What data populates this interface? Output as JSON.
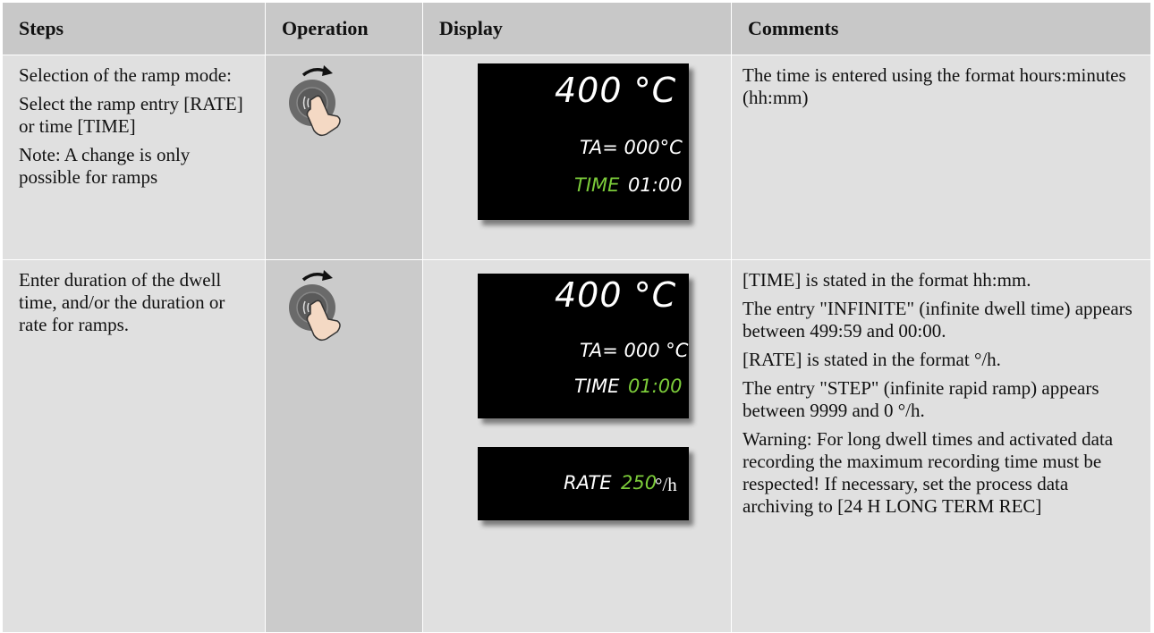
{
  "headers": {
    "steps": "Steps",
    "operation": "Operation",
    "display": "Display",
    "comments": "Comments"
  },
  "rows": [
    {
      "steps": [
        "Selection of the ramp mode:",
        "Select the ramp entry [RATE] or time [TIME]",
        "Note: A change is only possible for ramps"
      ],
      "display": {
        "temp": "400 °C",
        "ta": "TA= 000°C",
        "time_label": "TIME",
        "time_value": "01:00"
      },
      "comments": [
        "The time is entered using the format hours:minutes (hh:mm)"
      ]
    },
    {
      "steps": [
        "Enter duration of the dwell time, and/or the duration or rate for ramps."
      ],
      "display": {
        "temp": "400 °C",
        "ta": "TA= 000 °C",
        "time_label": "TIME",
        "time_value": "01:00",
        "rate_label": "RATE",
        "rate_value": "250",
        "rate_unit": "°/h"
      },
      "comments": [
        "[TIME] is stated in the format hh:mm.",
        "The entry \"INFINITE\" (infinite dwell time)  appears between 499:59 and 00:00.",
        "[RATE] is stated in the format °/h.",
        "The entry \"STEP\" (infinite rapid ramp) appears between 9999 and 0 °/h.",
        "Warning: For long dwell times and activated data recording the maximum recording time must be respected! If necessary, set the process data archiving to [24 H LONG TERM REC]"
      ]
    }
  ],
  "icons": {
    "operation": "rotate-knob-icon"
  },
  "colors": {
    "header_bg": "#c8c8c8",
    "cell_bg": "#e0e0e0",
    "operation_bg": "#cbcbcb",
    "lcd_bg": "#000000",
    "lcd_text": "#ffffff",
    "lcd_highlight": "#7ccc3a"
  }
}
